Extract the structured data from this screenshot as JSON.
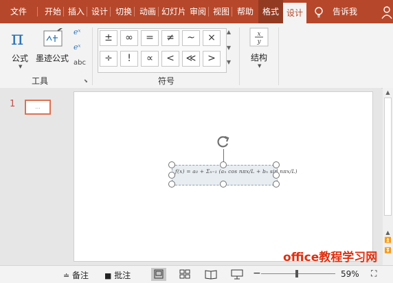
{
  "tabs": [
    {
      "label": "文件",
      "state": "normal"
    },
    {
      "label": "开始",
      "state": "normal"
    },
    {
      "label": "插入",
      "state": "normal"
    },
    {
      "label": "设计",
      "state": "normal"
    },
    {
      "label": "切换",
      "state": "normal"
    },
    {
      "label": "动画",
      "state": "normal"
    },
    {
      "label": "幻灯片",
      "state": "normal"
    },
    {
      "label": "审阅",
      "state": "normal"
    },
    {
      "label": "视图",
      "state": "normal"
    },
    {
      "label": "帮助",
      "state": "normal"
    },
    {
      "label": "格式",
      "state": "contextual"
    },
    {
      "label": "设计",
      "state": "active"
    }
  ],
  "tell_me": "告诉我",
  "ribbon": {
    "tools": {
      "equation_label": "公式",
      "ink_equation_label": "墨迹公式",
      "abc_label": "abc",
      "group_label": "工具"
    },
    "symbols": {
      "row1": [
        "±",
        "∞",
        "=",
        "≠",
        "~",
        "×"
      ],
      "row2": [
        "÷",
        "!",
        "∝",
        "<",
        "≪",
        ">"
      ],
      "group_label": "符号"
    },
    "structures": {
      "label": "结构"
    }
  },
  "slides": {
    "current_number": "1",
    "thumb_text": "..."
  },
  "equation": {
    "text": "f(x) = a₀ + Σₙ₌₁ (aₙ cos nπx/L + bₙ sin nπx/L)"
  },
  "status": {
    "notes": "备注",
    "comments": "批注",
    "zoom_percent": "59%"
  },
  "watermark": "office教程学习网",
  "colors": {
    "accent": "#b7472a",
    "contextual_tab": "#933a22",
    "watermark": "#e03010"
  }
}
